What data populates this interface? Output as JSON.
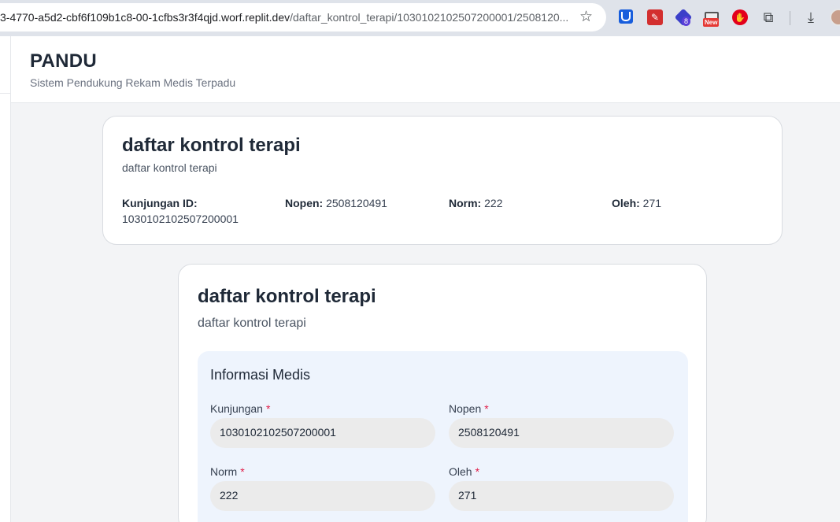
{
  "browser": {
    "url_host": "3-4770-a5d2-cbf6f109b1c8-00-1cfbs3r3f4qjd.worf.replit.dev",
    "url_path": "/daftar_kontrol_terapi/1030102102507200001/2508120...",
    "ext_badge_count": "8",
    "ext_new_badge": "New"
  },
  "app": {
    "title": "PANDU",
    "subtitle": "Sistem Pendukung Rekam Medis Terpadu"
  },
  "summary": {
    "title": "daftar kontrol terapi",
    "subtitle": "daftar kontrol terapi",
    "kunjungan_label": "Kunjungan ID:",
    "kunjungan_value": "1030102102507200001",
    "nopen_label": "Nopen:",
    "nopen_value": "2508120491",
    "norm_label": "Norm:",
    "norm_value": "222",
    "oleh_label": "Oleh:",
    "oleh_value": "271"
  },
  "form": {
    "title": "daftar kontrol terapi",
    "subtitle": "daftar kontrol terapi",
    "section_title": "Informasi Medis",
    "required_mark": "*",
    "fields": [
      {
        "label": "Kunjungan",
        "value": "1030102102507200001"
      },
      {
        "label": "Nopen",
        "value": "2508120491"
      },
      {
        "label": "Norm",
        "value": "222"
      },
      {
        "label": "Oleh",
        "value": "271"
      }
    ]
  },
  "colors": {
    "required": "#e11d48",
    "section_bg": "#eef4fd",
    "page_bg": "#f3f4f6"
  }
}
